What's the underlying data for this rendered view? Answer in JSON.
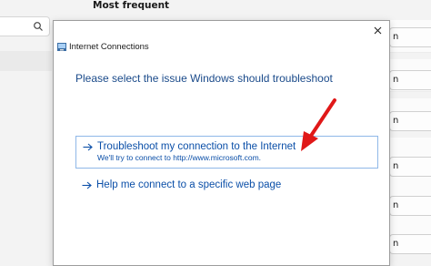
{
  "background": {
    "heading": "Most frequent",
    "run_label": "n",
    "card_count": 7
  },
  "dialog": {
    "title": "Internet Connections",
    "instruction": "Please select the issue Windows should troubleshoot",
    "options": [
      {
        "title": "Troubleshoot my connection to the Internet",
        "desc": "We'll try to connect to http://www.microsoft.com."
      },
      {
        "title": "Help me connect to a specific web page",
        "desc": ""
      }
    ]
  },
  "colors": {
    "link": "#0b4fa8",
    "instruction": "#1a4a8a",
    "annotation_arrow": "#e01818",
    "selected_border": "#8fb8e8"
  },
  "icons": {
    "close": "close-icon",
    "search": "search-icon",
    "option_arrow": "arrow-right-icon",
    "app": "network-icon",
    "annotation": "red-arrow-annotation"
  }
}
